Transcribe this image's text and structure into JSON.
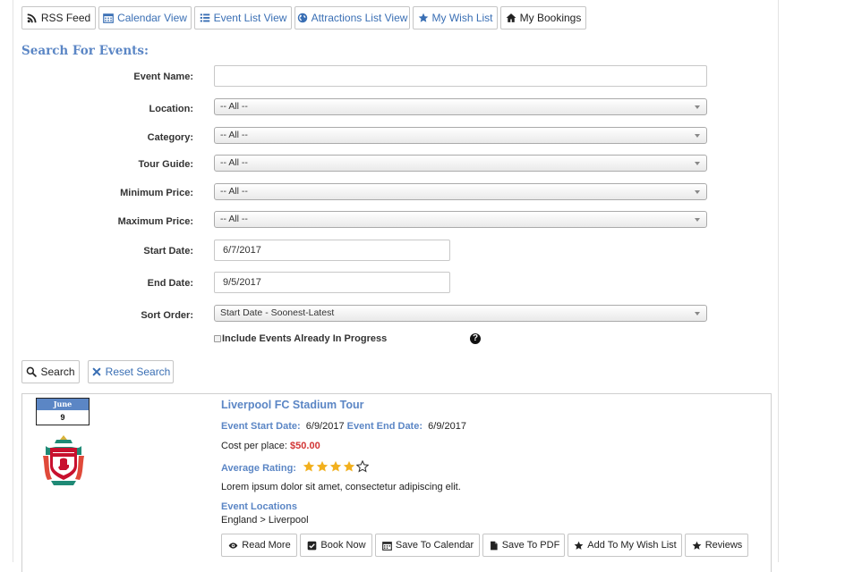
{
  "toolbar": {
    "rss": "RSS Feed",
    "calendar": "Calendar View",
    "event_list": "Event List View",
    "attractions": "Attractions List View",
    "wishlist": "My Wish List",
    "bookings": "My Bookings"
  },
  "search": {
    "title": "Search For Events:",
    "event_name_label": "Event Name:",
    "event_name_value": "",
    "location_label": "Location:",
    "location_value": "-- All --",
    "category_label": "Category:",
    "category_value": "-- All --",
    "tour_guide_label": "Tour Guide:",
    "tour_guide_value": "-- All --",
    "min_price_label": "Minimum Price:",
    "min_price_value": "-- All --",
    "max_price_label": "Maximum Price:",
    "max_price_value": "-- All --",
    "start_date_label": "Start Date:",
    "start_date_value": "6/7/2017",
    "end_date_label": "End Date:",
    "end_date_value": "9/5/2017",
    "sort_label": "Sort Order:",
    "sort_value": "Start Date - Soonest-Latest",
    "in_progress_label": "Include Events Already In Progress",
    "in_progress_checked": false,
    "search_button": "Search",
    "reset_button": "Reset Search"
  },
  "event": {
    "month": "June",
    "day": "9",
    "logo": "liverpool-fc-crest",
    "title": "Liverpool FC Stadium Tour",
    "start_label": "Event Start Date:",
    "start_value": "6/9/2017",
    "end_label": "Event End Date:",
    "end_value": "6/9/2017",
    "cost_label": "Cost per place:",
    "cost_value": "$50.00",
    "rating_label": "Average Rating:",
    "rating_stars": 4,
    "rating_max": 5,
    "description": "Lorem ipsum dolor sit amet, consectetur adipiscing elit.",
    "locations_label": "Event Locations",
    "locations_value": "England > Liverpool",
    "actions": {
      "read_more": "Read More",
      "book_now": "Book Now",
      "save_calendar": "Save To Calendar",
      "save_pdf": "Save To PDF",
      "add_wishlist": "Add To My Wish List",
      "reviews": "Reviews"
    }
  },
  "colors": {
    "accent": "#5b86c5",
    "link": "#3a6fb4",
    "price": "#d23535",
    "star": "#f2b01e"
  }
}
